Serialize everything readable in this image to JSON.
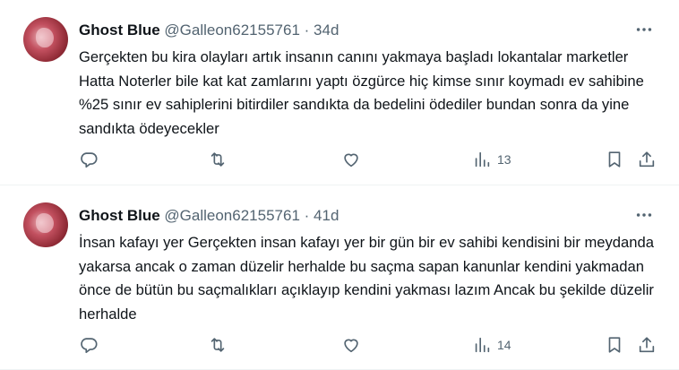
{
  "tweets": [
    {
      "name": "Ghost Blue",
      "handle": "@Galleon62155761",
      "separator": "·",
      "time": "34d",
      "text": "Gerçekten bu kira olayları artık insanın canını yakmaya başladı lokantalar marketler Hatta Noterler bile kat kat zamlarını yaptı özgürce hiç kimse sınır koymadı ev sahibine %25 sınır ev sahiplerini bitirdiler sandıkta da bedelini ödediler bundan sonra da yine sandıkta ödeyecekler",
      "views": "13"
    },
    {
      "name": "Ghost Blue",
      "handle": "@Galleon62155761",
      "separator": "·",
      "time": "41d",
      "text": "İnsan kafayı yer Gerçekten insan kafayı yer bir gün bir ev sahibi kendisini bir meydanda yakarsa ancak o zaman düzelir herhalde bu saçma sapan kanunlar kendini yakmadan önce de bütün bu saçmalıkları açıklayıp kendini yakması lazım Ancak bu şekilde düzelir herhalde",
      "views": "14"
    }
  ],
  "icons": {
    "more": "more-horizontal-icon",
    "reply": "reply-icon",
    "retweet": "retweet-icon",
    "like": "heart-icon",
    "views": "views-icon",
    "bookmark": "bookmark-icon",
    "share": "share-icon"
  },
  "colors": {
    "text": "#0f1419",
    "secondary": "#536471",
    "divider": "#eff3f4"
  }
}
